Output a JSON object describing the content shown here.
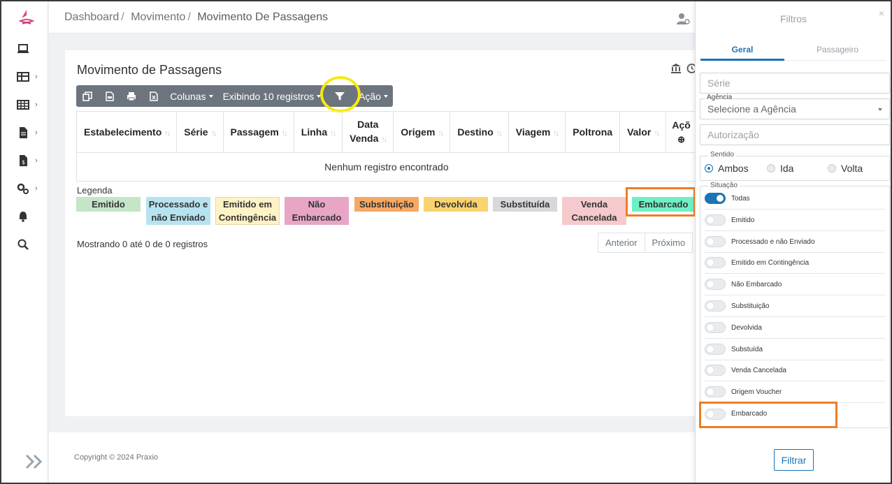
{
  "breadcrumb": {
    "item1": "Dashboard",
    "item2": "Movimento",
    "current": "Movimento De Passagens",
    "separator": "/"
  },
  "card": {
    "title": "Movimento de Passagens"
  },
  "toolbar": {
    "colunas": "Colunas",
    "exibindo": "Exibindo 10 registros",
    "acao": "Ação"
  },
  "table": {
    "columns": [
      {
        "label": "Estabelecimento"
      },
      {
        "label": "Série"
      },
      {
        "label": "Passagem"
      },
      {
        "label": "Linha"
      },
      {
        "label": "Data",
        "label2": "Venda"
      },
      {
        "label": "Origem"
      },
      {
        "label": "Destino"
      },
      {
        "label": "Viagem"
      },
      {
        "label": "Poltrona"
      },
      {
        "label": "Valor"
      },
      {
        "label": "Açõ"
      }
    ],
    "empty_message": "Nenhum registro encontrado"
  },
  "legend": {
    "title": "Legenda",
    "items": [
      {
        "label": "Emitido",
        "color": "#c4e5c6"
      },
      {
        "label": "Processado e não Enviado",
        "color": "#b7e3f0"
      },
      {
        "label": "Emitido em Contingência",
        "color": "#fff2c6"
      },
      {
        "label": "Não Embarcado",
        "color": "#e8a5c6"
      },
      {
        "label": "Substituição",
        "color": "#f7a865"
      },
      {
        "label": "Devolvida",
        "color": "#f9d36f"
      },
      {
        "label": "Substituída",
        "color": "#d6d8db"
      },
      {
        "label": "Venda Cancelada",
        "color": "#f6c9cd"
      },
      {
        "label": "Embarcado",
        "color": "#6ff0c4"
      }
    ]
  },
  "pagination": {
    "info": "Mostrando 0 até 0 de 0 registros",
    "previous": "Anterior",
    "next": "Próximo"
  },
  "footer": {
    "copyright": "Copyright © 2024 Praxio"
  },
  "filters": {
    "title": "Filtros",
    "close": "×",
    "tabs": [
      "Geral",
      "Passageiro"
    ],
    "serie_placeholder": "Série",
    "agencia_label": "Agência",
    "agencia_value": "Selecione a Agência",
    "autorizacao_placeholder": "Autorização",
    "sentido_label": "Sentido",
    "sentido_options": [
      "Ambos",
      "Ida",
      "Volta"
    ],
    "sentido_selected": "Ambos",
    "situacao_label": "Situação",
    "situacao_options": [
      {
        "label": "Todas",
        "on": true
      },
      {
        "label": "Emitido",
        "on": false
      },
      {
        "label": "Processado e não Enviado",
        "on": false
      },
      {
        "label": "Emitido em Contingência",
        "on": false
      },
      {
        "label": "Não Embarcado",
        "on": false
      },
      {
        "label": "Substituição",
        "on": false
      },
      {
        "label": "Devolvida",
        "on": false
      },
      {
        "label": "Substuída",
        "on": false
      },
      {
        "label": "Venda Cancelada",
        "on": false
      },
      {
        "label": "Origem Voucher",
        "on": false
      },
      {
        "label": "Embarcado",
        "on": false
      }
    ],
    "submit": "Filtrar"
  },
  "colors": {
    "accent": "#1a74b8",
    "highlight_orange": "#f07d24",
    "highlight_yellow": "#f5ea12",
    "toolbar": "#6c757d"
  }
}
